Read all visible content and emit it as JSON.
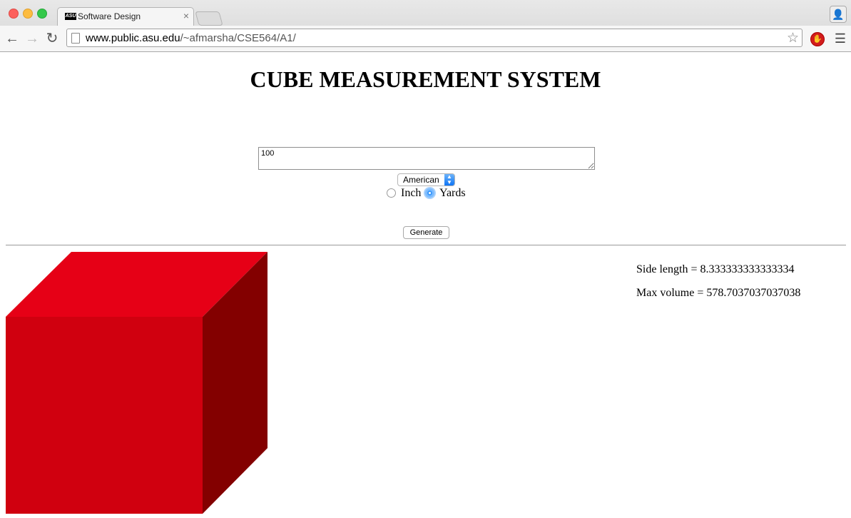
{
  "browser": {
    "tab_title": "Software Design",
    "tab_favicon_text": "ASU",
    "url_host": "www.public.asu.edu",
    "url_path": "/~afmarsha/CSE564/A1/"
  },
  "page": {
    "title": "CUBE MEASUREMENT SYSTEM",
    "input_value": "100",
    "system_select": "American",
    "radio_inch_label": "Inch",
    "radio_yards_label": "Yards",
    "selected_unit": "Yards",
    "generate_label": "Generate"
  },
  "results": {
    "side_length": "Side length = 8.333333333333334",
    "max_volume": "Max volume = 578.7037037037038"
  },
  "colors": {
    "cube_front": "#d0000f",
    "cube_top": "#e60016",
    "cube_side": "#830000"
  }
}
